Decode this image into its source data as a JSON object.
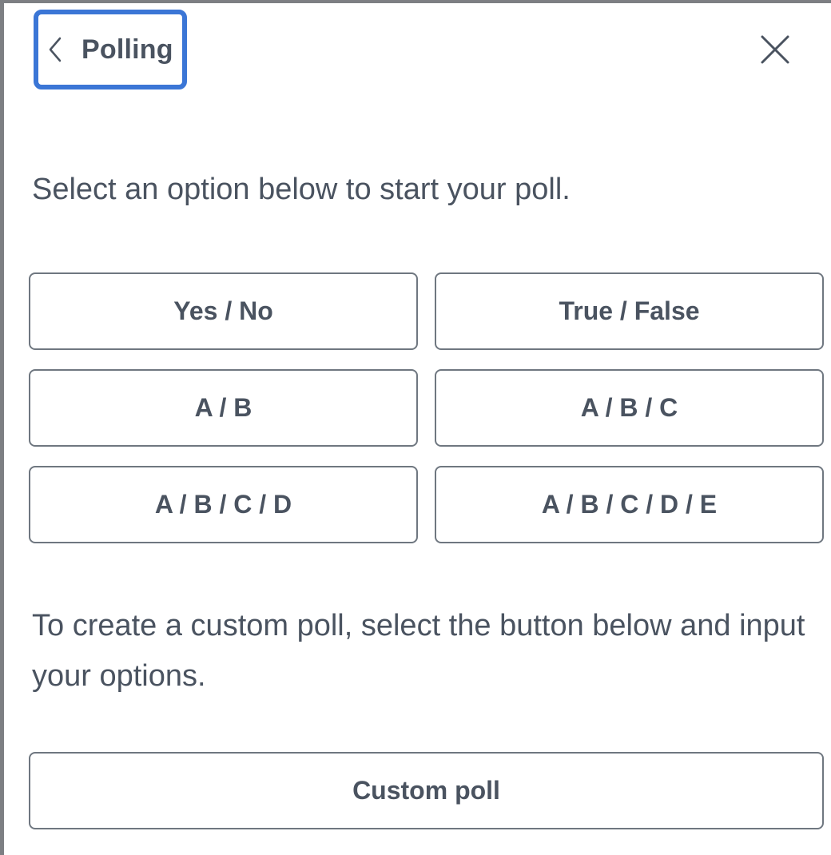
{
  "header": {
    "back_icon": "chevron-left-icon",
    "title": "Polling",
    "close_icon": "close-icon",
    "focus_color": "#3b76d6"
  },
  "intro_text": "Select an option below to start your poll.",
  "options": [
    {
      "label": "Yes / No"
    },
    {
      "label": "True / False"
    },
    {
      "label": "A / B"
    },
    {
      "label": "A / B / C"
    },
    {
      "label": "A / B / C / D"
    },
    {
      "label": "A / B / C / D / E"
    }
  ],
  "custom": {
    "description": "To create a custom poll, select the button below and input your options.",
    "button_label": "Custom poll"
  },
  "colors": {
    "text": "#4a5360",
    "border": "#6f7780"
  }
}
